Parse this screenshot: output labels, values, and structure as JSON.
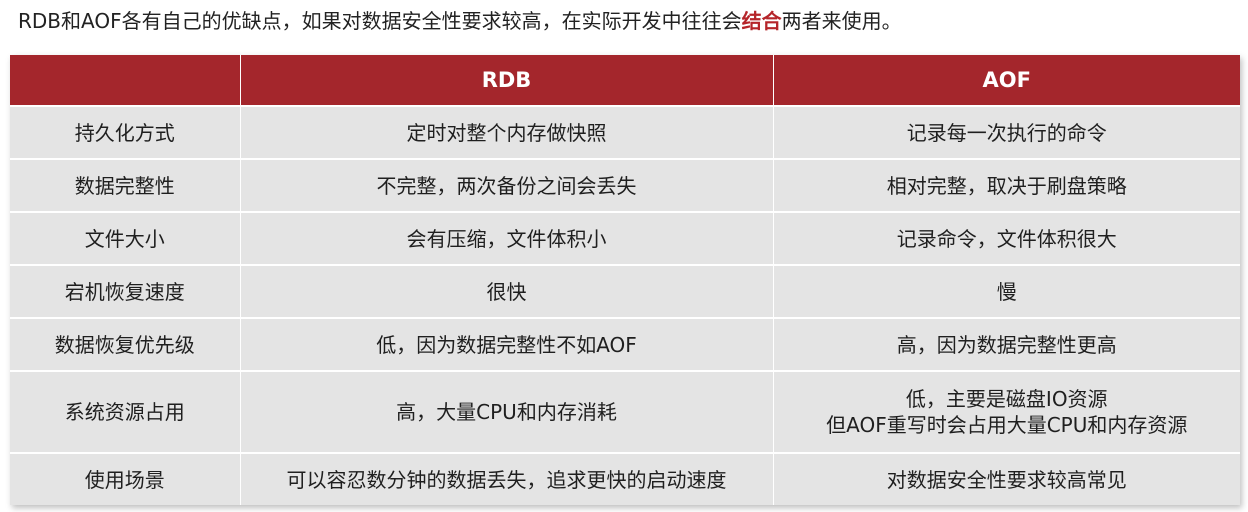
{
  "intro": {
    "before": "RDB和AOF各有自己的优缺点，如果对数据安全性要求较高，在实际开发中往往会",
    "highlight": "结合",
    "after": "两者来使用。"
  },
  "table": {
    "headers": [
      "",
      "RDB",
      "AOF"
    ],
    "rows": [
      {
        "label": "持久化方式",
        "rdb": [
          "定时对整个内存做快照"
        ],
        "aof": [
          "记录每一次执行的命令"
        ]
      },
      {
        "label": "数据完整性",
        "rdb": [
          "不完整，两次备份之间会丢失"
        ],
        "aof": [
          "相对完整，取决于刷盘策略"
        ]
      },
      {
        "label": "文件大小",
        "rdb": [
          "会有压缩，文件体积小"
        ],
        "aof": [
          "记录命令，文件体积很大"
        ]
      },
      {
        "label": "宕机恢复速度",
        "rdb": [
          "很快"
        ],
        "aof": [
          "慢"
        ]
      },
      {
        "label": "数据恢复优先级",
        "rdb": [
          "低，因为数据完整性不如AOF"
        ],
        "aof": [
          "高，因为数据完整性更高"
        ]
      },
      {
        "label": "系统资源占用",
        "rdb": [
          "高，大量CPU和内存消耗"
        ],
        "aof": [
          "低，主要是磁盘IO资源",
          "但AOF重写时会占用大量CPU和内存资源"
        ]
      },
      {
        "label": "使用场景",
        "rdb": [
          "可以容忍数分钟的数据丢失，追求更快的启动速度"
        ],
        "aof": [
          "对数据安全性要求较高常见"
        ]
      }
    ]
  },
  "colors": {
    "header_bg": "#a4262c",
    "cell_bg": "#e4e4e4",
    "highlight": "#b5252a"
  }
}
